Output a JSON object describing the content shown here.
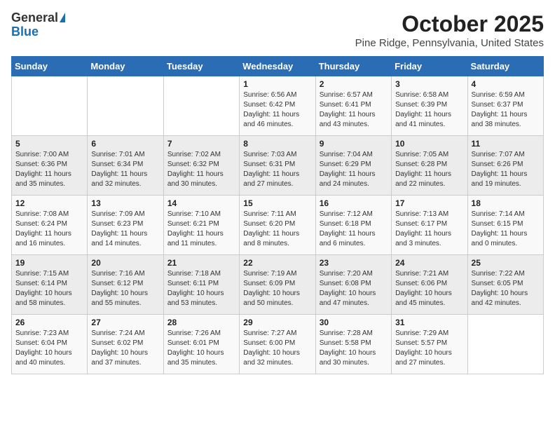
{
  "logo": {
    "general": "General",
    "blue": "Blue"
  },
  "title": "October 2025",
  "subtitle": "Pine Ridge, Pennsylvania, United States",
  "days_of_week": [
    "Sunday",
    "Monday",
    "Tuesday",
    "Wednesday",
    "Thursday",
    "Friday",
    "Saturday"
  ],
  "weeks": [
    [
      {
        "day": "",
        "info": ""
      },
      {
        "day": "",
        "info": ""
      },
      {
        "day": "",
        "info": ""
      },
      {
        "day": "1",
        "info": "Sunrise: 6:56 AM\nSunset: 6:42 PM\nDaylight: 11 hours\nand 46 minutes."
      },
      {
        "day": "2",
        "info": "Sunrise: 6:57 AM\nSunset: 6:41 PM\nDaylight: 11 hours\nand 43 minutes."
      },
      {
        "day": "3",
        "info": "Sunrise: 6:58 AM\nSunset: 6:39 PM\nDaylight: 11 hours\nand 41 minutes."
      },
      {
        "day": "4",
        "info": "Sunrise: 6:59 AM\nSunset: 6:37 PM\nDaylight: 11 hours\nand 38 minutes."
      }
    ],
    [
      {
        "day": "5",
        "info": "Sunrise: 7:00 AM\nSunset: 6:36 PM\nDaylight: 11 hours\nand 35 minutes."
      },
      {
        "day": "6",
        "info": "Sunrise: 7:01 AM\nSunset: 6:34 PM\nDaylight: 11 hours\nand 32 minutes."
      },
      {
        "day": "7",
        "info": "Sunrise: 7:02 AM\nSunset: 6:32 PM\nDaylight: 11 hours\nand 30 minutes."
      },
      {
        "day": "8",
        "info": "Sunrise: 7:03 AM\nSunset: 6:31 PM\nDaylight: 11 hours\nand 27 minutes."
      },
      {
        "day": "9",
        "info": "Sunrise: 7:04 AM\nSunset: 6:29 PM\nDaylight: 11 hours\nand 24 minutes."
      },
      {
        "day": "10",
        "info": "Sunrise: 7:05 AM\nSunset: 6:28 PM\nDaylight: 11 hours\nand 22 minutes."
      },
      {
        "day": "11",
        "info": "Sunrise: 7:07 AM\nSunset: 6:26 PM\nDaylight: 11 hours\nand 19 minutes."
      }
    ],
    [
      {
        "day": "12",
        "info": "Sunrise: 7:08 AM\nSunset: 6:24 PM\nDaylight: 11 hours\nand 16 minutes."
      },
      {
        "day": "13",
        "info": "Sunrise: 7:09 AM\nSunset: 6:23 PM\nDaylight: 11 hours\nand 14 minutes."
      },
      {
        "day": "14",
        "info": "Sunrise: 7:10 AM\nSunset: 6:21 PM\nDaylight: 11 hours\nand 11 minutes."
      },
      {
        "day": "15",
        "info": "Sunrise: 7:11 AM\nSunset: 6:20 PM\nDaylight: 11 hours\nand 8 minutes."
      },
      {
        "day": "16",
        "info": "Sunrise: 7:12 AM\nSunset: 6:18 PM\nDaylight: 11 hours\nand 6 minutes."
      },
      {
        "day": "17",
        "info": "Sunrise: 7:13 AM\nSunset: 6:17 PM\nDaylight: 11 hours\nand 3 minutes."
      },
      {
        "day": "18",
        "info": "Sunrise: 7:14 AM\nSunset: 6:15 PM\nDaylight: 11 hours\nand 0 minutes."
      }
    ],
    [
      {
        "day": "19",
        "info": "Sunrise: 7:15 AM\nSunset: 6:14 PM\nDaylight: 10 hours\nand 58 minutes."
      },
      {
        "day": "20",
        "info": "Sunrise: 7:16 AM\nSunset: 6:12 PM\nDaylight: 10 hours\nand 55 minutes."
      },
      {
        "day": "21",
        "info": "Sunrise: 7:18 AM\nSunset: 6:11 PM\nDaylight: 10 hours\nand 53 minutes."
      },
      {
        "day": "22",
        "info": "Sunrise: 7:19 AM\nSunset: 6:09 PM\nDaylight: 10 hours\nand 50 minutes."
      },
      {
        "day": "23",
        "info": "Sunrise: 7:20 AM\nSunset: 6:08 PM\nDaylight: 10 hours\nand 47 minutes."
      },
      {
        "day": "24",
        "info": "Sunrise: 7:21 AM\nSunset: 6:06 PM\nDaylight: 10 hours\nand 45 minutes."
      },
      {
        "day": "25",
        "info": "Sunrise: 7:22 AM\nSunset: 6:05 PM\nDaylight: 10 hours\nand 42 minutes."
      }
    ],
    [
      {
        "day": "26",
        "info": "Sunrise: 7:23 AM\nSunset: 6:04 PM\nDaylight: 10 hours\nand 40 minutes."
      },
      {
        "day": "27",
        "info": "Sunrise: 7:24 AM\nSunset: 6:02 PM\nDaylight: 10 hours\nand 37 minutes."
      },
      {
        "day": "28",
        "info": "Sunrise: 7:26 AM\nSunset: 6:01 PM\nDaylight: 10 hours\nand 35 minutes."
      },
      {
        "day": "29",
        "info": "Sunrise: 7:27 AM\nSunset: 6:00 PM\nDaylight: 10 hours\nand 32 minutes."
      },
      {
        "day": "30",
        "info": "Sunrise: 7:28 AM\nSunset: 5:58 PM\nDaylight: 10 hours\nand 30 minutes."
      },
      {
        "day": "31",
        "info": "Sunrise: 7:29 AM\nSunset: 5:57 PM\nDaylight: 10 hours\nand 27 minutes."
      },
      {
        "day": "",
        "info": ""
      }
    ]
  ]
}
